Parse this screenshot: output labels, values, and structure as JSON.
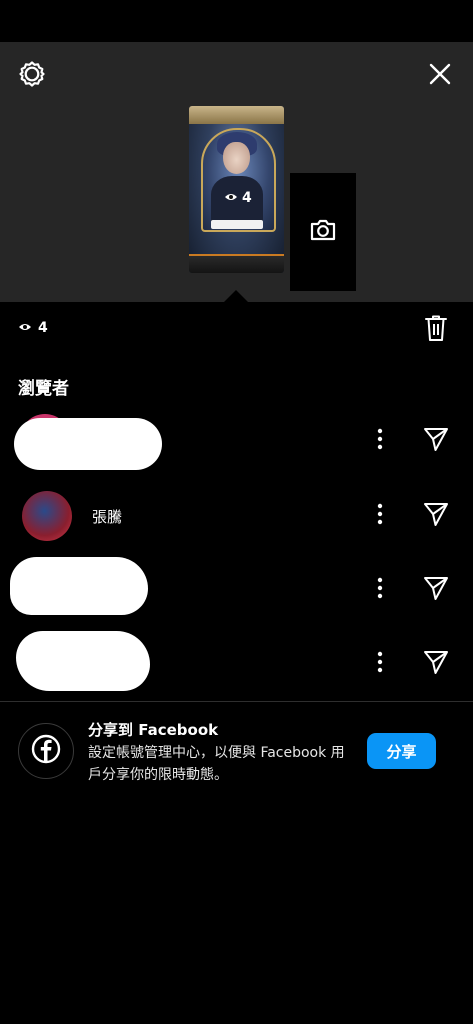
{
  "header": {
    "settings_icon": "gear-icon",
    "close_icon": "close-icon"
  },
  "story": {
    "views": "4"
  },
  "views_summary": {
    "count": "4"
  },
  "viewers_section": {
    "title": "瀏覽者"
  },
  "viewers": [
    {
      "name": ""
    },
    {
      "name": "張騰"
    },
    {
      "name": ""
    },
    {
      "name": ""
    }
  ],
  "facebook_share": {
    "title": "分享到 Facebook",
    "description": "設定帳號管理中心，以便與 Facebook 用戶分享你的限時動態。",
    "button_label": "分享"
  },
  "colors": {
    "top_area_bg": "#262626",
    "accent_blue": "#0a95f6"
  }
}
